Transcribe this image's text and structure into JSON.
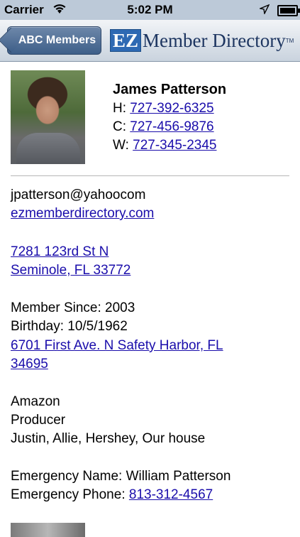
{
  "status_bar": {
    "carrier": "Carrier",
    "time": "5:02 PM"
  },
  "nav": {
    "back_label": "ABC Members",
    "logo_ez": "EZ",
    "logo_text": "Member Directory",
    "logo_tm": "TM"
  },
  "member": {
    "name": "James Patterson",
    "phones": [
      {
        "prefix": "H:",
        "number": "727-392-6325"
      },
      {
        "prefix": "C:",
        "number": "727-456-9876"
      },
      {
        "prefix": "W:",
        "number": "727-345-2345"
      }
    ],
    "email": "jpatterson@yahoocom",
    "website": "ezmemberdirectory.com",
    "address_line1": "7281 123rd St N",
    "address_line2": "Seminole, FL 33772",
    "member_since": "Member Since: 2003",
    "birthday": "Birthday: 10/5/1962",
    "alt_address_line1": "6701 First Ave. N Safety Harbor, FL",
    "alt_address_line2": "34695",
    "company": "Amazon",
    "title": "Producer",
    "family": "Justin, Allie, Hershey, Our house",
    "emergency_name": "Emergency Name: William Patterson",
    "emergency_phone_label": "Emergency Phone:",
    "emergency_phone": "813-312-4567"
  }
}
